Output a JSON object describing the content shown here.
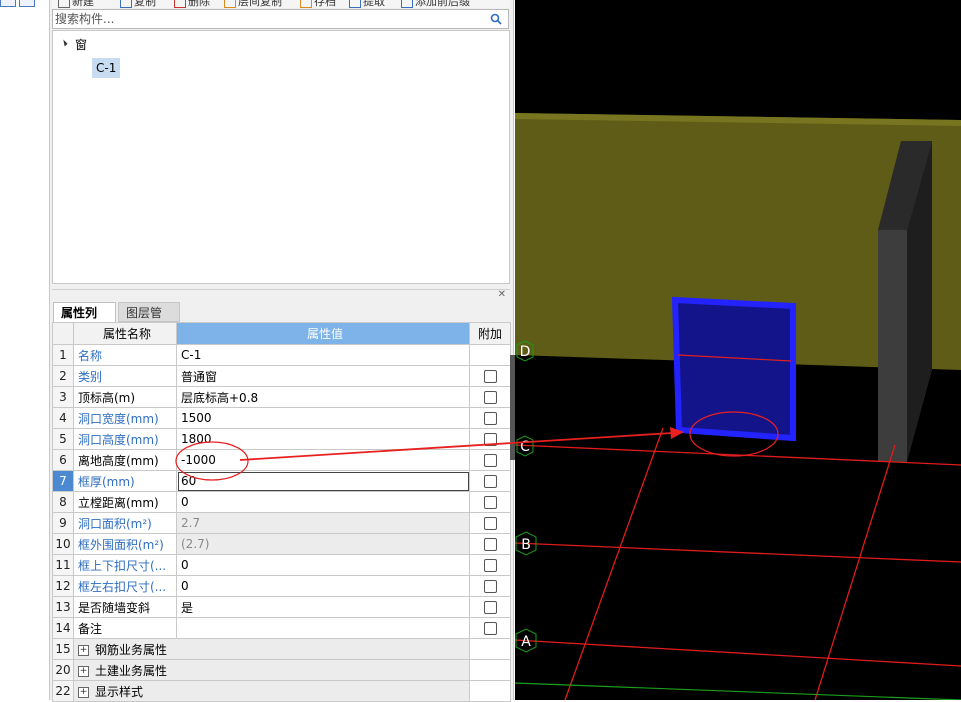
{
  "toolbar": {
    "items": [
      {
        "label": "新建",
        "icon": "new-icon"
      },
      {
        "label": "复制",
        "icon": "copy-icon"
      },
      {
        "label": "删除",
        "icon": "delete-icon"
      },
      {
        "label": "层间复制",
        "icon": "floor-copy-icon"
      },
      {
        "label": "存档",
        "icon": "archive-icon"
      },
      {
        "label": "提取",
        "icon": "extract-icon"
      },
      {
        "label": "添加前后缀",
        "icon": "prefix-suffix-icon"
      }
    ]
  },
  "search": {
    "placeholder": "搜索构件..."
  },
  "tree": {
    "root": "窗",
    "child": "C-1"
  },
  "property_panel": {
    "tabs": [
      "属性列表",
      "图层管理"
    ],
    "headers": {
      "num": "",
      "name": "属性名称",
      "value": "属性值",
      "add": "附加"
    },
    "rows": [
      {
        "num": "1",
        "name": "名称",
        "value": "C-1",
        "blue": true,
        "checkbox": false
      },
      {
        "num": "2",
        "name": "类别",
        "value": "普通窗",
        "blue": true,
        "checkbox": true
      },
      {
        "num": "3",
        "name": "顶标高(m)",
        "value": "层底标高+0.8",
        "blue": false,
        "checkbox": true
      },
      {
        "num": "4",
        "name": "洞口宽度(mm)",
        "value": "1500",
        "blue": true,
        "checkbox": true
      },
      {
        "num": "5",
        "name": "洞口高度(mm)",
        "value": "1800",
        "blue": true,
        "checkbox": true
      },
      {
        "num": "6",
        "name": "离地高度(mm)",
        "value": "-1000",
        "blue": false,
        "checkbox": true
      },
      {
        "num": "7",
        "name": "框厚(mm)",
        "value": "60",
        "blue": true,
        "checkbox": true,
        "selected": true
      },
      {
        "num": "8",
        "name": "立樘距离(mm)",
        "value": "0",
        "blue": false,
        "checkbox": true
      },
      {
        "num": "9",
        "name": "洞口面积(m²)",
        "value": "2.7",
        "blue": true,
        "checkbox": true,
        "gray": true
      },
      {
        "num": "10",
        "name": "框外围面积(m²)",
        "value": "(2.7)",
        "blue": true,
        "checkbox": true,
        "gray": true
      },
      {
        "num": "11",
        "name": "框上下扣尺寸(...",
        "value": "0",
        "blue": true,
        "checkbox": true
      },
      {
        "num": "12",
        "name": "框左右扣尺寸(...",
        "value": "0",
        "blue": true,
        "checkbox": true
      },
      {
        "num": "13",
        "name": "是否随墙变斜",
        "value": "是",
        "blue": false,
        "checkbox": true
      },
      {
        "num": "14",
        "name": "备注",
        "value": "",
        "blue": false,
        "checkbox": true
      }
    ],
    "groups": [
      {
        "num": "15",
        "name": "钢筋业务属性"
      },
      {
        "num": "20",
        "name": "土建业务属性"
      },
      {
        "num": "22",
        "name": "显示样式"
      }
    ]
  },
  "viewport": {
    "axis_labels": [
      "D",
      "C",
      "B",
      "A"
    ],
    "colors": {
      "background": "#000000",
      "wall": "#5e5c17",
      "window": "#14148a",
      "window_edge": "#2323ff",
      "gridline": "#e01b1b",
      "axis_label": "#1a9e1a",
      "annotation": "#e82020"
    }
  }
}
